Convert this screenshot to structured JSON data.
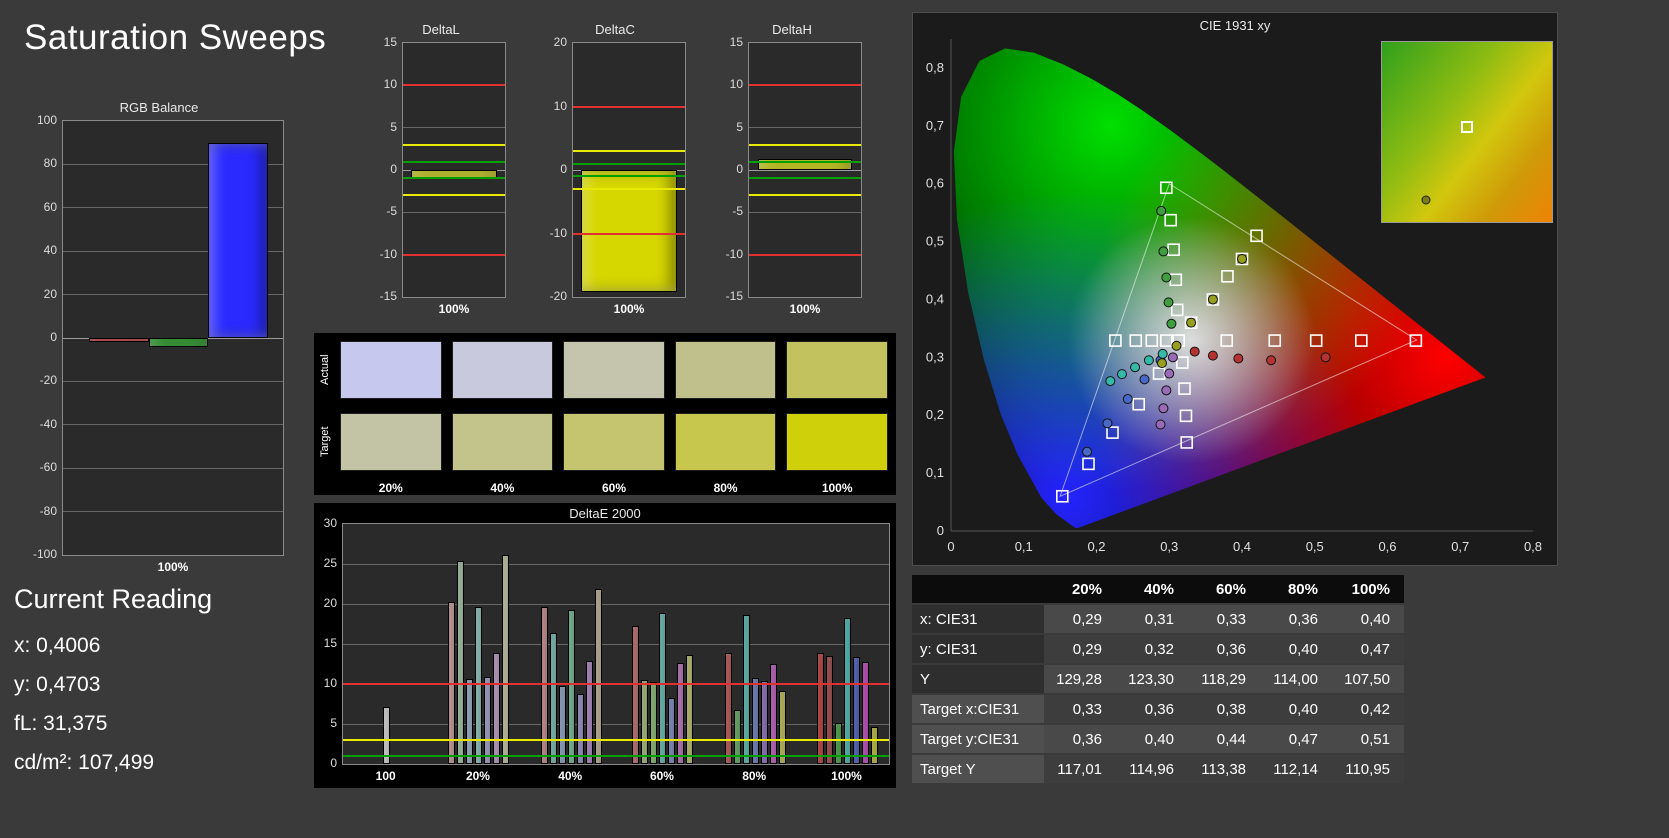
{
  "app": {
    "title": "Saturation Sweeps"
  },
  "current_reading": {
    "heading": "Current Reading",
    "lines": [
      "x: 0,4006",
      "y: 0,4703",
      "fL: 31,375",
      "cd/m²: 107,499"
    ]
  },
  "swatches": {
    "row_labels": [
      "Actual",
      "Target"
    ],
    "col_labels": [
      "20%",
      "40%",
      "60%",
      "80%",
      "100%"
    ],
    "actual": [
      "#c7c8ee",
      "#c9c9dd",
      "#c5c5ad",
      "#c0c08c",
      "#c2c25e"
    ],
    "target": [
      "#c3c3a6",
      "#c3c38c",
      "#c5c570",
      "#c7c74e",
      "#d0d00a"
    ]
  },
  "table": {
    "header": [
      "",
      "20%",
      "40%",
      "60%",
      "80%",
      "100%"
    ],
    "rows": [
      {
        "label": "x: CIE31",
        "values": [
          "0,29",
          "0,31",
          "0,33",
          "0,36",
          "0,40"
        ]
      },
      {
        "label": "y: CIE31",
        "values": [
          "0,29",
          "0,32",
          "0,36",
          "0,40",
          "0,47"
        ]
      },
      {
        "label": "Y",
        "values": [
          "129,28",
          "123,30",
          "118,29",
          "114,00",
          "107,50"
        ]
      },
      {
        "label": "Target x:CIE31",
        "values": [
          "0,33",
          "0,36",
          "0,38",
          "0,40",
          "0,42"
        ]
      },
      {
        "label": "Target y:CIE31",
        "values": [
          "0,36",
          "0,40",
          "0,44",
          "0,47",
          "0,51"
        ]
      },
      {
        "label": "Target Y",
        "values": [
          "117,01",
          "114,96",
          "113,38",
          "112,14",
          "110,95"
        ]
      }
    ]
  },
  "chart_data": [
    {
      "id": "rgb_balance",
      "type": "bar",
      "title": "RGB Balance",
      "xlabel": "100%",
      "categories": [
        "Red",
        "Green",
        "Blue"
      ],
      "values": [
        -2,
        -4,
        90
      ],
      "bar_colors": [
        "#d21616",
        "#0f9a0f",
        "#2a2aff"
      ],
      "ylim": [
        -100,
        100
      ],
      "yticks": [
        100,
        80,
        60,
        40,
        20,
        0,
        -20,
        -40,
        -60,
        -80,
        -100
      ]
    },
    {
      "id": "delta_l",
      "type": "bar",
      "title": "DeltaL",
      "xlabel": "100%",
      "categories": [
        "100%"
      ],
      "values": [
        -1.0
      ],
      "bar_colors": [
        "#d6d600"
      ],
      "ylim": [
        -15,
        15
      ],
      "yticks": [
        15,
        10,
        5,
        0,
        -5,
        -10,
        -15
      ],
      "ref_lines": [
        {
          "value": 10,
          "color": "#e03030"
        },
        {
          "value": -10,
          "color": "#e03030"
        },
        {
          "value": 3,
          "color": "#e8e800"
        },
        {
          "value": -3,
          "color": "#e8e800"
        },
        {
          "value": 1,
          "color": "#00a000"
        },
        {
          "value": -1,
          "color": "#00a000"
        }
      ]
    },
    {
      "id": "delta_c",
      "type": "bar",
      "title": "DeltaC",
      "xlabel": "100%",
      "categories": [
        "100%"
      ],
      "values": [
        -19.2
      ],
      "bar_colors": [
        "#d6d600"
      ],
      "ylim": [
        -20,
        20
      ],
      "yticks": [
        20,
        10,
        0,
        -10,
        -20
      ],
      "ref_lines": [
        {
          "value": 10,
          "color": "#e03030"
        },
        {
          "value": -10,
          "color": "#e03030"
        },
        {
          "value": 3,
          "color": "#e8e800"
        },
        {
          "value": -3,
          "color": "#e8e800"
        },
        {
          "value": 1,
          "color": "#00a000"
        },
        {
          "value": -1,
          "color": "#00a000"
        }
      ]
    },
    {
      "id": "delta_h",
      "type": "bar",
      "title": "DeltaH",
      "xlabel": "100%",
      "categories": [
        "100%"
      ],
      "values": [
        1.3
      ],
      "bar_colors": [
        "#d6d600"
      ],
      "ylim": [
        -15,
        15
      ],
      "yticks": [
        15,
        10,
        5,
        0,
        -5,
        -10,
        -15
      ],
      "ref_lines": [
        {
          "value": 10,
          "color": "#e03030"
        },
        {
          "value": -10,
          "color": "#e03030"
        },
        {
          "value": 3,
          "color": "#e8e800"
        },
        {
          "value": -3,
          "color": "#e8e800"
        },
        {
          "value": 1,
          "color": "#00a000"
        },
        {
          "value": -1,
          "color": "#00a000"
        }
      ]
    },
    {
      "id": "delta_e_2000",
      "type": "bar",
      "title": "DeltaE 2000",
      "ylim": [
        0,
        30
      ],
      "yticks": [
        0,
        5,
        10,
        15,
        20,
        25,
        30
      ],
      "ref_lines": [
        {
          "value": 10,
          "color": "#e03030"
        },
        {
          "value": 3,
          "color": "#e8e800"
        },
        {
          "value": 1,
          "color": "#00a000"
        }
      ],
      "group_centers": [
        0.08,
        0.249,
        0.418,
        0.586,
        0.755,
        0.924
      ],
      "groups": [
        {
          "label": "100",
          "bars": [
            {
              "v": 7.1,
              "c": "#f2f2f2"
            }
          ]
        },
        {
          "label": "20%",
          "bars": [
            {
              "v": 20.2,
              "c": "#dd9a9a"
            },
            {
              "v": 25.4,
              "c": "#a9d6a9"
            },
            {
              "v": 10.6,
              "c": "#9ab8dd"
            },
            {
              "v": 19.6,
              "c": "#85d6cd"
            },
            {
              "v": 10.9,
              "c": "#a7a3dd"
            },
            {
              "v": 13.9,
              "c": "#c79ad9"
            },
            {
              "v": 26.1,
              "c": "#d6d6a0"
            }
          ]
        },
        {
          "label": "40%",
          "bars": [
            {
              "v": 19.6,
              "c": "#d98484"
            },
            {
              "v": 16.4,
              "c": "#63c9b9"
            },
            {
              "v": 9.7,
              "c": "#84a6d9"
            },
            {
              "v": 19.3,
              "c": "#5fc994"
            },
            {
              "v": 8.7,
              "c": "#928bd9"
            },
            {
              "v": 12.9,
              "c": "#b77cd4"
            },
            {
              "v": 21.9,
              "c": "#cdbb8c"
            }
          ]
        },
        {
          "label": "60%",
          "bars": [
            {
              "v": 17.3,
              "c": "#d05454"
            },
            {
              "v": 10.5,
              "c": "#a9c964"
            },
            {
              "v": 10.3,
              "c": "#7ec95e"
            },
            {
              "v": 18.9,
              "c": "#46c9bd"
            },
            {
              "v": 8.3,
              "c": "#6d82d0"
            },
            {
              "v": 12.6,
              "c": "#c95cc9"
            },
            {
              "v": 13.6,
              "c": "#c9d04e"
            }
          ]
        },
        {
          "label": "80%",
          "bars": [
            {
              "v": 13.9,
              "c": "#cc3232"
            },
            {
              "v": 6.7,
              "c": "#44b244"
            },
            {
              "v": 18.6,
              "c": "#35c9ba"
            },
            {
              "v": 10.7,
              "c": "#4f72cf"
            },
            {
              "v": 10.4,
              "c": "#8459cc"
            },
            {
              "v": 12.5,
              "c": "#cc3ecc"
            },
            {
              "v": 9.1,
              "c": "#cccc30"
            }
          ]
        },
        {
          "label": "100%",
          "bars": [
            {
              "v": 13.9,
              "c": "#cc1111"
            },
            {
              "v": 13.5,
              "c": "#a02020"
            },
            {
              "v": 5.1,
              "c": "#1ca91c"
            },
            {
              "v": 18.3,
              "c": "#1fc9bd"
            },
            {
              "v": 13.4,
              "c": "#2141cc"
            },
            {
              "v": 12.8,
              "c": "#cc1ecc"
            },
            {
              "v": 4.6,
              "c": "#cccc0e"
            }
          ]
        }
      ]
    },
    {
      "id": "cie_1931",
      "type": "scatter",
      "title": "CIE 1931 xy",
      "xlim": [
        0,
        0.8
      ],
      "ylim": [
        0,
        0.85
      ],
      "xticks": [
        0,
        0.1,
        0.2,
        0.3,
        0.4,
        0.5,
        0.6,
        0.7,
        0.8
      ],
      "yticks": [
        0,
        0.1,
        0.2,
        0.3,
        0.4,
        0.5,
        0.6,
        0.7,
        0.8
      ],
      "primaries": {
        "red": "#ff0000",
        "green": "#00e000",
        "blue": "#2424ff"
      },
      "gamut_triangle": [
        [
          0.64,
          0.33
        ],
        [
          0.3,
          0.6
        ],
        [
          0.15,
          0.06
        ]
      ],
      "locus": [
        [
          0.1741,
          0.005
        ],
        [
          0.1714,
          0.0051
        ],
        [
          0.1644,
          0.0109
        ],
        [
          0.144,
          0.0297
        ],
        [
          0.1241,
          0.0578
        ],
        [
          0.0913,
          0.1327
        ],
        [
          0.0687,
          0.2007
        ],
        [
          0.0454,
          0.295
        ],
        [
          0.0235,
          0.4127
        ],
        [
          0.0082,
          0.5384
        ],
        [
          0.0039,
          0.6548
        ],
        [
          0.0139,
          0.7502
        ],
        [
          0.0389,
          0.812
        ],
        [
          0.0743,
          0.8338
        ],
        [
          0.1142,
          0.8262
        ],
        [
          0.1547,
          0.8059
        ],
        [
          0.1929,
          0.7816
        ],
        [
          0.2296,
          0.7543
        ],
        [
          0.2658,
          0.7243
        ],
        [
          0.3016,
          0.6923
        ],
        [
          0.3373,
          0.6589
        ],
        [
          0.3731,
          0.6245
        ],
        [
          0.4087,
          0.5896
        ],
        [
          0.4441,
          0.5547
        ],
        [
          0.4788,
          0.5202
        ],
        [
          0.5125,
          0.4866
        ],
        [
          0.5448,
          0.4544
        ],
        [
          0.5752,
          0.4242
        ],
        [
          0.6029,
          0.3965
        ],
        [
          0.627,
          0.3725
        ],
        [
          0.6482,
          0.3514
        ],
        [
          0.6658,
          0.334
        ],
        [
          0.6915,
          0.3083
        ],
        [
          0.7079,
          0.292
        ],
        [
          0.719,
          0.2809
        ],
        [
          0.726,
          0.274
        ],
        [
          0.7347,
          0.2653
        ]
      ],
      "targets": [
        [
          0.313,
          0.329
        ],
        [
          0.379,
          0.329
        ],
        [
          0.445,
          0.329
        ],
        [
          0.502,
          0.329
        ],
        [
          0.564,
          0.329
        ],
        [
          0.639,
          0.329
        ],
        [
          0.311,
          0.382
        ],
        [
          0.309,
          0.434
        ],
        [
          0.306,
          0.486
        ],
        [
          0.302,
          0.537
        ],
        [
          0.296,
          0.593
        ],
        [
          0.286,
          0.272
        ],
        [
          0.258,
          0.219
        ],
        [
          0.222,
          0.17
        ],
        [
          0.189,
          0.116
        ],
        [
          0.153,
          0.06
        ],
        [
          0.296,
          0.329
        ],
        [
          0.276,
          0.329
        ],
        [
          0.254,
          0.329
        ],
        [
          0.226,
          0.329
        ],
        [
          0.318,
          0.291
        ],
        [
          0.321,
          0.246
        ],
        [
          0.323,
          0.199
        ],
        [
          0.324,
          0.153
        ],
        [
          0.33,
          0.36
        ],
        [
          0.36,
          0.4
        ],
        [
          0.38,
          0.44
        ],
        [
          0.4,
          0.47
        ],
        [
          0.42,
          0.51
        ]
      ],
      "measurements": [
        {
          "x": 0.335,
          "y": 0.31,
          "c": "#b43232"
        },
        {
          "x": 0.36,
          "y": 0.303,
          "c": "#b43232"
        },
        {
          "x": 0.395,
          "y": 0.298,
          "c": "#b43232"
        },
        {
          "x": 0.44,
          "y": 0.295,
          "c": "#b43232"
        },
        {
          "x": 0.515,
          "y": 0.3,
          "c": "#b43232"
        },
        {
          "x": 0.303,
          "y": 0.358,
          "c": "#3f9e3f"
        },
        {
          "x": 0.299,
          "y": 0.395,
          "c": "#3f9e3f"
        },
        {
          "x": 0.296,
          "y": 0.438,
          "c": "#3f9e3f"
        },
        {
          "x": 0.292,
          "y": 0.483,
          "c": "#3f9e3f"
        },
        {
          "x": 0.289,
          "y": 0.553,
          "c": "#3f9e3f"
        },
        {
          "x": 0.288,
          "y": 0.295,
          "c": "#4868c8"
        },
        {
          "x": 0.266,
          "y": 0.262,
          "c": "#4868c8"
        },
        {
          "x": 0.243,
          "y": 0.228,
          "c": "#4868c8"
        },
        {
          "x": 0.215,
          "y": 0.186,
          "c": "#4868c8"
        },
        {
          "x": 0.187,
          "y": 0.137,
          "c": "#4868c8"
        },
        {
          "x": 0.291,
          "y": 0.306,
          "c": "#35b9a9"
        },
        {
          "x": 0.272,
          "y": 0.295,
          "c": "#35b9a9"
        },
        {
          "x": 0.253,
          "y": 0.283,
          "c": "#35b9a9"
        },
        {
          "x": 0.235,
          "y": 0.271,
          "c": "#35b9a9"
        },
        {
          "x": 0.219,
          "y": 0.259,
          "c": "#35b9a9"
        },
        {
          "x": 0.305,
          "y": 0.3,
          "c": "#9a6ab8"
        },
        {
          "x": 0.3,
          "y": 0.272,
          "c": "#9a6ab8"
        },
        {
          "x": 0.296,
          "y": 0.243,
          "c": "#9a6ab8"
        },
        {
          "x": 0.292,
          "y": 0.212,
          "c": "#9a6ab8"
        },
        {
          "x": 0.288,
          "y": 0.184,
          "c": "#9a6ab8"
        },
        {
          "x": 0.29,
          "y": 0.29,
          "c": "#97a01e"
        },
        {
          "x": 0.31,
          "y": 0.32,
          "c": "#97a01e"
        },
        {
          "x": 0.33,
          "y": 0.36,
          "c": "#97a01e"
        },
        {
          "x": 0.36,
          "y": 0.4,
          "c": "#97a01e"
        },
        {
          "x": 0.4,
          "y": 0.47,
          "c": "#97a01e"
        }
      ],
      "inset": {
        "square": [
          0.5,
          0.47
        ],
        "dot": [
          0.26,
          0.88
        ]
      }
    }
  ]
}
